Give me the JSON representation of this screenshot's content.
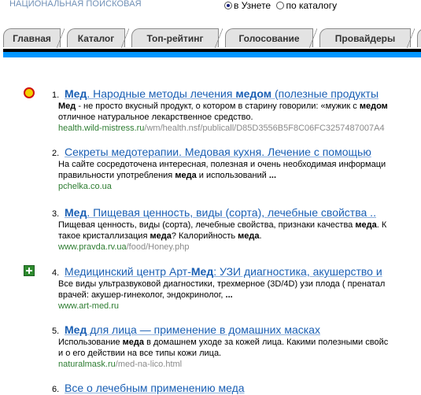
{
  "header": {
    "tagline": "НАЦИОНАЛЬНАЯ ПОИСКОВАЯ",
    "radio_uznete": "в Узнете",
    "radio_catalog": "по каталогу"
  },
  "tabs": [
    {
      "label": "Главная"
    },
    {
      "label": "Каталог"
    },
    {
      "label": "Топ-рейтинг"
    },
    {
      "label": "Голосование"
    },
    {
      "label": "Провайдеры"
    }
  ],
  "results": [
    {
      "num": "1.",
      "title_bold": "Мед",
      "title_mid": ". Народные методы лечения ",
      "title_bold2": "медом",
      "title_end": " (полезные продукты",
      "snippet1_bold": "Мед",
      "snippet1": " - не просто вкусный продукт, о котором в старину говорили: «мужик с ",
      "snippet1_bold_end": "медом",
      "snippet2": "отличное натуральное лекарственное средство.",
      "url_host": "health.wild-mistress.ru",
      "url_path": "/wm/health.nsf/publicall/D85D3556B5F8C06FC3257487007A4",
      "icon": "sun-icon"
    },
    {
      "num": "2.",
      "title": "Секреты медотерапии. Медовая кухня. Лечение с помощью",
      "snippet1": "На сайте сосредоточена интересная, полезная и очень необходимая информаци",
      "snippet2a": "правильности употребления ",
      "snippet2_bold": "меда",
      "snippet2b": " и использований ",
      "snippet2_end": "...",
      "url_host": "pchelka.co.ua"
    },
    {
      "num": "3.",
      "title_bold": "Мед",
      "title_end": ". Пищевая ценность, виды (сорта), лечебные свойства ..",
      "snippet1a": "Пищевая ценность, виды (сорта), лечебные свойства, признаки качества ",
      "snippet1_bold": "меда",
      "snippet1b": ". К",
      "snippet2a": "такое кристаллизация ",
      "snippet2_bold": "меда",
      "snippet2b": "? Калорийность ",
      "snippet2_bold2": "меда",
      "snippet2c": ".",
      "url_host": "www.pravda.rv.ua",
      "url_path": "/food/Honey.php"
    },
    {
      "num": "4.",
      "title_start": "Медицинский центр Арт-",
      "title_bold": "Мед",
      "title_end": ": УЗИ диагностика, акушерство и",
      "snippet1": "Все виды ультразвуковой диагностики, трехмерное (3D/4D) узи плода ( пренатал",
      "snippet2": "врачей: акушер-гинеколог, эндокринолог, ",
      "snippet2_end": "...",
      "url_host": "www.art-med.ru",
      "icon": "medical-cross-icon"
    },
    {
      "num": "5.",
      "title_bold": "Мед",
      "title_end": " для лица — применение в домашних масках",
      "snippet1a": "Использование ",
      "snippet1_bold": "меда",
      "snippet1b": " в домашнем уходе за кожей лица. Какими полезными свойс",
      "snippet2": "и о его действии на все типы кожи лица.",
      "url_host": "naturalmask.ru",
      "url_path": "/med-na-lico.html"
    }
  ],
  "partial_result": {
    "num": "6.",
    "title": "Все о лечебным применению меда"
  }
}
